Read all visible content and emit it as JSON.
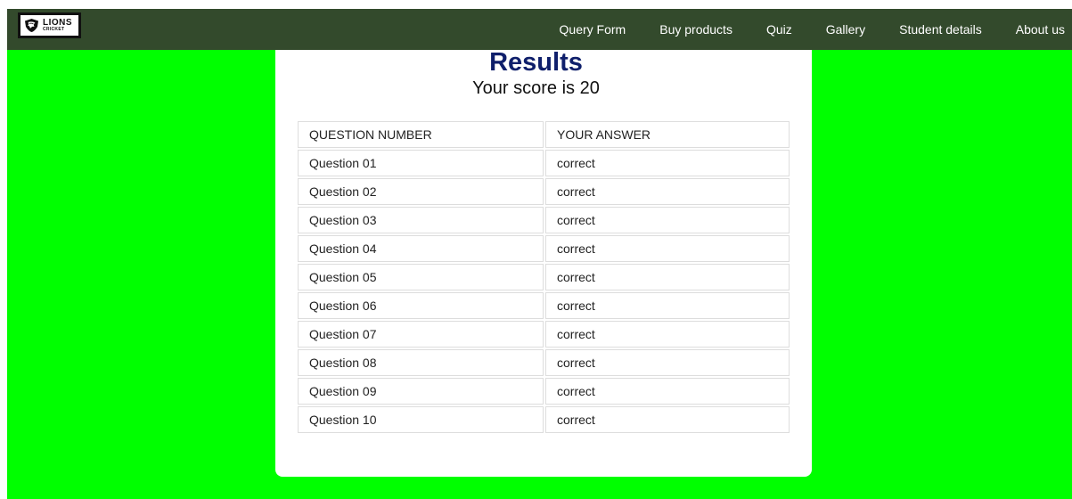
{
  "header": {
    "logo": {
      "main": "LIONS",
      "sub": "CRICKET"
    },
    "nav": [
      {
        "label": "Query Form"
      },
      {
        "label": "Buy products"
      },
      {
        "label": "Quiz"
      },
      {
        "label": "Gallery"
      },
      {
        "label": "Student details"
      },
      {
        "label": "About us"
      }
    ]
  },
  "results": {
    "title": "Results",
    "score_text": "Your score is 20",
    "columns": [
      "QUESTION NUMBER",
      "YOUR ANSWER"
    ],
    "rows": [
      {
        "question": "Question 01",
        "answer": "correct"
      },
      {
        "question": "Question 02",
        "answer": "correct"
      },
      {
        "question": "Question 03",
        "answer": "correct"
      },
      {
        "question": "Question 04",
        "answer": "correct"
      },
      {
        "question": "Question 05",
        "answer": "correct"
      },
      {
        "question": "Question 06",
        "answer": "correct"
      },
      {
        "question": "Question 07",
        "answer": "correct"
      },
      {
        "question": "Question 08",
        "answer": "correct"
      },
      {
        "question": "Question 09",
        "answer": "correct"
      },
      {
        "question": "Question 10",
        "answer": "correct"
      }
    ]
  },
  "colors": {
    "background": "#00ff00",
    "navbar": "#334a2c",
    "title": "#0f1f6b",
    "card": "#ffffff"
  }
}
